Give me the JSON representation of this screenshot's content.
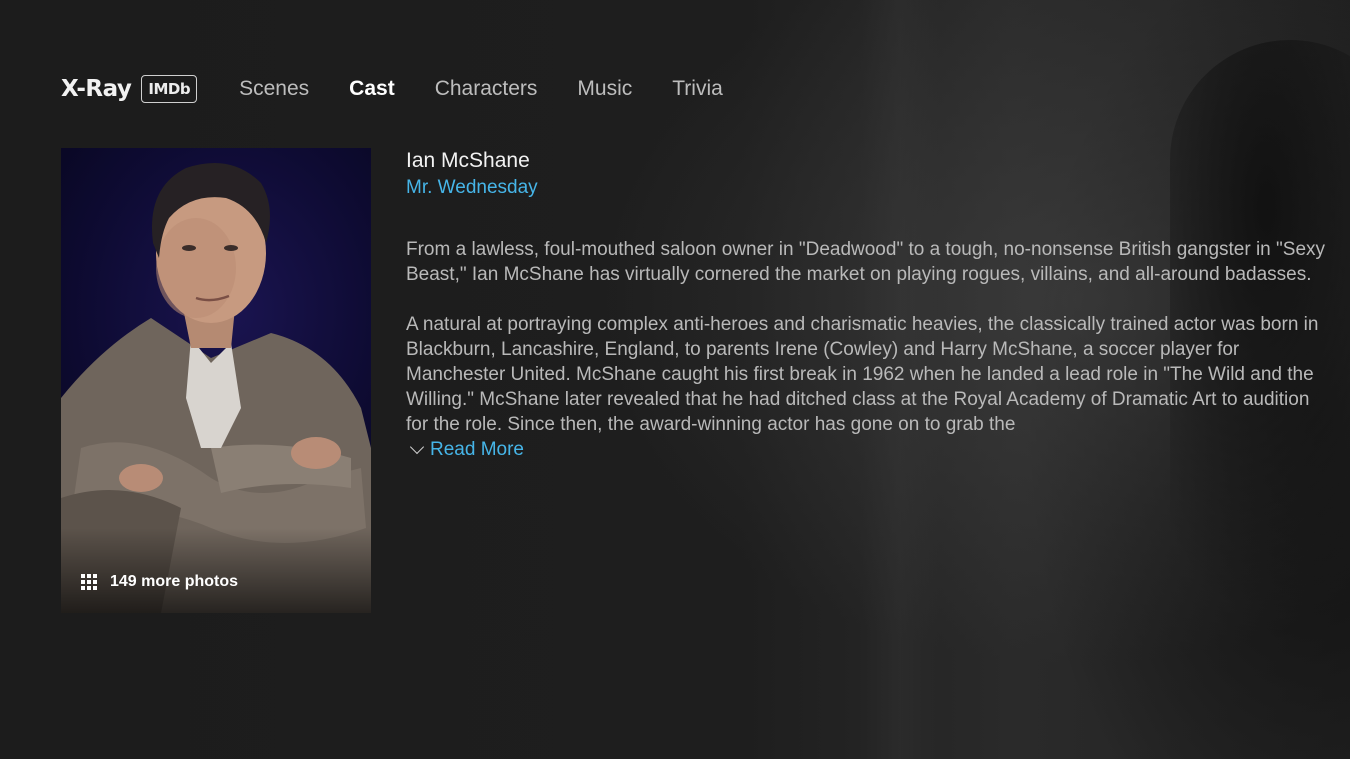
{
  "header": {
    "brand": "X-Ray",
    "badge": "IMDb",
    "tabs": [
      {
        "label": "Scenes"
      },
      {
        "label": "Cast"
      },
      {
        "label": "Characters"
      },
      {
        "label": "Music"
      },
      {
        "label": "Trivia"
      }
    ],
    "active_tab": "Cast"
  },
  "portrait": {
    "more_photos_label": "149 more photos",
    "icon": "grid-icon"
  },
  "detail": {
    "actor_name": "Ian McShane",
    "character_name": "Mr. Wednesday",
    "bio_paragraphs": [
      "From a lawless, foul-mouthed saloon owner in \"Deadwood\" to a tough, no-nonsense British gangster in \"Sexy Beast,\" Ian McShane has virtually cornered the market on playing rogues, villains, and all-around badasses.",
      "A natural at portraying complex anti-heroes and charismatic heavies, the classically trained actor was born in Blackburn, Lancashire, England, to parents Irene (Cowley) and Harry McShane, a soccer player for Manchester United. McShane caught his first break in 1962 when he landed a lead role in \"The Wild and the Willing.\" McShane later revealed that he had ditched class at the Royal Academy of Dramatic Art to audition for the role. Since then, the award-winning actor has gone on to grab the"
    ],
    "read_more_label": "Read More",
    "read_more_icon": "chevron-down-icon"
  },
  "colors": {
    "accent": "#46b5e8",
    "background": "#1b1b1b",
    "text_primary": "#f2f2f2",
    "text_secondary": "#b9b9b9"
  }
}
